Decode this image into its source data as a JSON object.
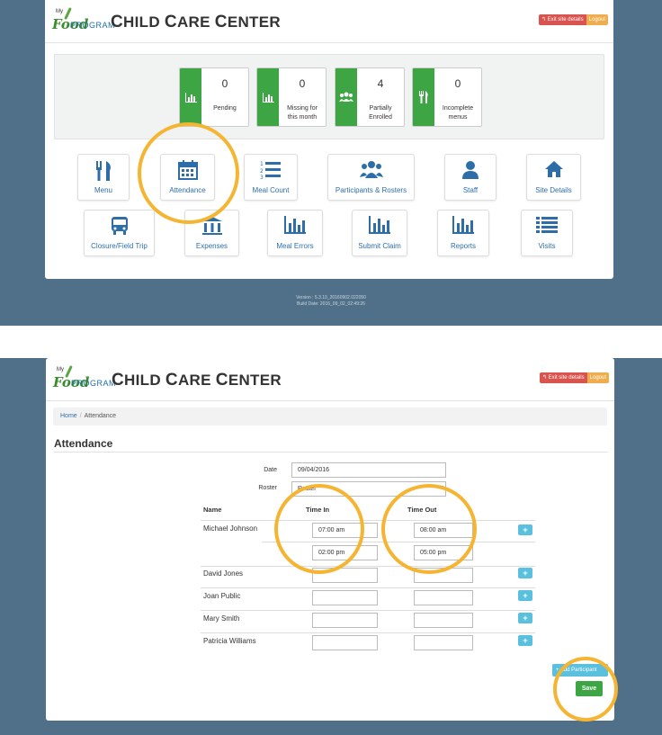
{
  "app": {
    "logo_my": "My",
    "logo_food": "Food",
    "logo_program": "PROGRAM",
    "title_first": "C",
    "title_first_rest": "HILD ",
    "title_second": "C",
    "title_second_rest": "ARE ",
    "title_third": "C",
    "title_third_rest": "ENTER",
    "exit_label": "↰ Exit site details",
    "logout_label": "Logout"
  },
  "dashboard": {
    "stats": [
      {
        "value": "0",
        "label_line1": "Pending",
        "label_line2": "",
        "icon": "bar-chart-icon"
      },
      {
        "value": "0",
        "label_line1": "Missing for",
        "label_line2": "this month",
        "icon": "bar-chart-icon"
      },
      {
        "value": "4",
        "label_line1": "Partially",
        "label_line2": "Enrolled",
        "icon": "group-icon"
      },
      {
        "value": "0",
        "label_line1": "Incomplete",
        "label_line2": "menus",
        "icon": "utensils-icon"
      }
    ],
    "tiles": [
      {
        "label": "Menu",
        "icon": "utensils-icon"
      },
      {
        "label": "Attendance",
        "icon": "calendar-icon"
      },
      {
        "label": "Meal Count",
        "icon": "numbered-list-icon"
      },
      {
        "label": "Participants & Rosters",
        "icon": "group-icon"
      },
      {
        "label": "Staff",
        "icon": "user-icon"
      },
      {
        "label": "Site Details",
        "icon": "home-icon"
      },
      {
        "label": "Closure/Field Trip",
        "icon": "bus-icon"
      },
      {
        "label": "Expenses",
        "icon": "bank-icon"
      },
      {
        "label": "Meal Errors",
        "icon": "bar-chart-icon"
      },
      {
        "label": "Submit Claim",
        "icon": "bar-chart-icon"
      },
      {
        "label": "Reports",
        "icon": "bar-chart-icon"
      },
      {
        "label": "Visits",
        "icon": "list-icon"
      }
    ],
    "version_line1": "Version : 5.3.10_20160902.022050",
    "version_line2": "Build Date: 2016_09_02_02:49:26"
  },
  "attendance": {
    "breadcrumb_home": "Home",
    "breadcrumb_sep": "/",
    "breadcrumb_current": "Attendance",
    "page_title": "Attendance",
    "date_label": "Date",
    "date_value": "09/04/2016",
    "roster_label": "Roster",
    "roster_value": "Roster",
    "col_name": "Name",
    "col_time_in": "Time In",
    "col_time_out": "Time Out",
    "participants": [
      {
        "name": "Michael Johnson",
        "in1": "07:00 am",
        "out1": "08:00 am",
        "in2": "02:00 pm",
        "out2": "05:00 pm"
      },
      {
        "name": "David Jones",
        "in1": "",
        "out1": ""
      },
      {
        "name": "Joan Public",
        "in1": "",
        "out1": ""
      },
      {
        "name": "Mary Smith",
        "in1": "",
        "out1": ""
      },
      {
        "name": "Patricia Williams",
        "in1": "",
        "out1": ""
      }
    ],
    "plus_label": "+",
    "add_participant_label": "+ Add Participant",
    "save_label": "Save"
  },
  "colors": {
    "background": "#4f7088",
    "accent_green": "#3ea544",
    "icon_blue": "#2e6ea8",
    "highlight_circle": "#f5b432",
    "exit_red": "#d9534f",
    "logout_orange": "#f0ad4e",
    "info_cyan": "#5bc0de"
  }
}
